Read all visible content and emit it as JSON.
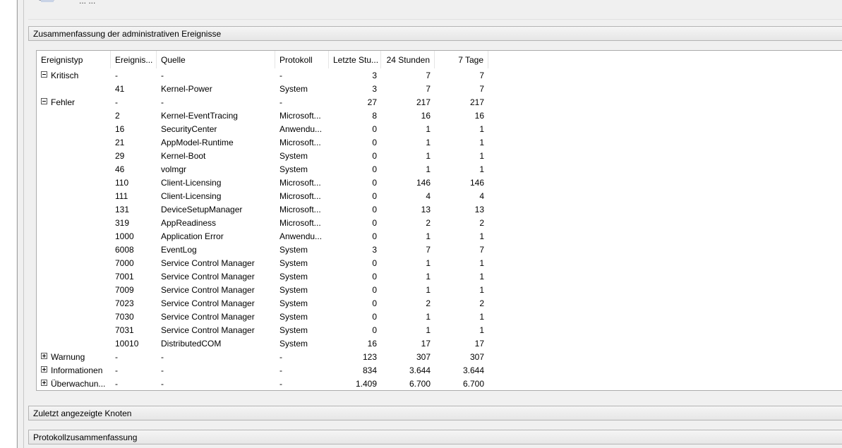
{
  "top": {
    "title_fragment": "... ..."
  },
  "sections": {
    "admin_summary": "Zusammenfassung der administrativen Ereignisse",
    "recent_nodes": "Zuletzt angezeigte Knoten",
    "log_summary": "Protokollzusammenfassung"
  },
  "table": {
    "headers": [
      "Ereignistyp",
      "Ereignis...",
      "Quelle",
      "Protokoll",
      "Letzte Stu...",
      "24 Stunden",
      "7 Tage"
    ],
    "rows": [
      {
        "toggle": "minus",
        "type": "Kritisch",
        "id": "-",
        "source": "-",
        "log": "-",
        "last_hour": "3",
        "day": "7",
        "week": "7"
      },
      {
        "toggle": "",
        "type": "",
        "id": "41",
        "source": "Kernel-Power",
        "log": "System",
        "last_hour": "3",
        "day": "7",
        "week": "7"
      },
      {
        "toggle": "minus",
        "type": "Fehler",
        "id": "-",
        "source": "-",
        "log": "-",
        "last_hour": "27",
        "day": "217",
        "week": "217"
      },
      {
        "toggle": "",
        "type": "",
        "id": "2",
        "source": "Kernel-EventTracing",
        "log": "Microsoft...",
        "last_hour": "8",
        "day": "16",
        "week": "16"
      },
      {
        "toggle": "",
        "type": "",
        "id": "16",
        "source": "SecurityCenter",
        "log": "Anwendu...",
        "last_hour": "0",
        "day": "1",
        "week": "1"
      },
      {
        "toggle": "",
        "type": "",
        "id": "21",
        "source": "AppModel-Runtime",
        "log": "Microsoft...",
        "last_hour": "0",
        "day": "1",
        "week": "1"
      },
      {
        "toggle": "",
        "type": "",
        "id": "29",
        "source": "Kernel-Boot",
        "log": "System",
        "last_hour": "0",
        "day": "1",
        "week": "1"
      },
      {
        "toggle": "",
        "type": "",
        "id": "46",
        "source": "volmgr",
        "log": "System",
        "last_hour": "0",
        "day": "1",
        "week": "1"
      },
      {
        "toggle": "",
        "type": "",
        "id": "110",
        "source": "Client-Licensing",
        "log": "Microsoft...",
        "last_hour": "0",
        "day": "146",
        "week": "146"
      },
      {
        "toggle": "",
        "type": "",
        "id": "111",
        "source": "Client-Licensing",
        "log": "Microsoft...",
        "last_hour": "0",
        "day": "4",
        "week": "4"
      },
      {
        "toggle": "",
        "type": "",
        "id": "131",
        "source": "DeviceSetupManager",
        "log": "Microsoft...",
        "last_hour": "0",
        "day": "13",
        "week": "13"
      },
      {
        "toggle": "",
        "type": "",
        "id": "319",
        "source": "AppReadiness",
        "log": "Microsoft...",
        "last_hour": "0",
        "day": "2",
        "week": "2"
      },
      {
        "toggle": "",
        "type": "",
        "id": "1000",
        "source": "Application Error",
        "log": "Anwendu...",
        "last_hour": "0",
        "day": "1",
        "week": "1"
      },
      {
        "toggle": "",
        "type": "",
        "id": "6008",
        "source": "EventLog",
        "log": "System",
        "last_hour": "3",
        "day": "7",
        "week": "7"
      },
      {
        "toggle": "",
        "type": "",
        "id": "7000",
        "source": "Service Control Manager",
        "log": "System",
        "last_hour": "0",
        "day": "1",
        "week": "1"
      },
      {
        "toggle": "",
        "type": "",
        "id": "7001",
        "source": "Service Control Manager",
        "log": "System",
        "last_hour": "0",
        "day": "1",
        "week": "1"
      },
      {
        "toggle": "",
        "type": "",
        "id": "7009",
        "source": "Service Control Manager",
        "log": "System",
        "last_hour": "0",
        "day": "1",
        "week": "1"
      },
      {
        "toggle": "",
        "type": "",
        "id": "7023",
        "source": "Service Control Manager",
        "log": "System",
        "last_hour": "0",
        "day": "2",
        "week": "2"
      },
      {
        "toggle": "",
        "type": "",
        "id": "7030",
        "source": "Service Control Manager",
        "log": "System",
        "last_hour": "0",
        "day": "1",
        "week": "1"
      },
      {
        "toggle": "",
        "type": "",
        "id": "7031",
        "source": "Service Control Manager",
        "log": "System",
        "last_hour": "0",
        "day": "1",
        "week": "1"
      },
      {
        "toggle": "",
        "type": "",
        "id": "10010",
        "source": "DistributedCOM",
        "log": "System",
        "last_hour": "16",
        "day": "17",
        "week": "17"
      },
      {
        "toggle": "plus",
        "type": "Warnung",
        "id": "-",
        "source": "-",
        "log": "-",
        "last_hour": "123",
        "day": "307",
        "week": "307"
      },
      {
        "toggle": "plus",
        "type": "Informationen",
        "id": "-",
        "source": "-",
        "log": "-",
        "last_hour": "834",
        "day": "3.644",
        "week": "3.644"
      },
      {
        "toggle": "plus",
        "type": "Überwachun...",
        "id": "-",
        "source": "-",
        "log": "-",
        "last_hour": "1.409",
        "day": "6.700",
        "week": "6.700"
      }
    ]
  },
  "colors": {
    "panel_bg": "#f0f0f0",
    "grid_bg": "#ffffff",
    "border": "#acacac"
  }
}
